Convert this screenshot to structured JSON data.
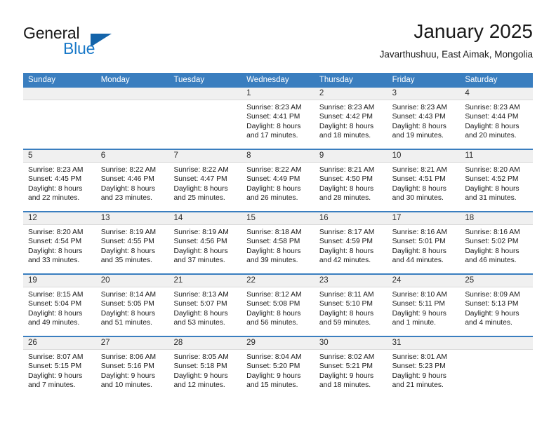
{
  "brand": {
    "name_part1": "General",
    "name_part2": "Blue",
    "accent_color": "#1878c8",
    "triangle_color": "#1464aa"
  },
  "header": {
    "month_title": "January 2025",
    "location": "Javarthushuu, East Aimak, Mongolia"
  },
  "theme": {
    "header_row_color": "#3a7ebf",
    "day_band_color": "#f0f0f0",
    "text_color": "#1a1a1a"
  },
  "weekdays": [
    "Sunday",
    "Monday",
    "Tuesday",
    "Wednesday",
    "Thursday",
    "Friday",
    "Saturday"
  ],
  "weeks": [
    [
      {
        "day": "",
        "empty": true
      },
      {
        "day": "",
        "empty": true
      },
      {
        "day": "",
        "empty": true
      },
      {
        "day": "1",
        "sunrise": "Sunrise: 8:23 AM",
        "sunset": "Sunset: 4:41 PM",
        "daylight1": "Daylight: 8 hours",
        "daylight2": "and 17 minutes."
      },
      {
        "day": "2",
        "sunrise": "Sunrise: 8:23 AM",
        "sunset": "Sunset: 4:42 PM",
        "daylight1": "Daylight: 8 hours",
        "daylight2": "and 18 minutes."
      },
      {
        "day": "3",
        "sunrise": "Sunrise: 8:23 AM",
        "sunset": "Sunset: 4:43 PM",
        "daylight1": "Daylight: 8 hours",
        "daylight2": "and 19 minutes."
      },
      {
        "day": "4",
        "sunrise": "Sunrise: 8:23 AM",
        "sunset": "Sunset: 4:44 PM",
        "daylight1": "Daylight: 8 hours",
        "daylight2": "and 20 minutes."
      }
    ],
    [
      {
        "day": "5",
        "sunrise": "Sunrise: 8:23 AM",
        "sunset": "Sunset: 4:45 PM",
        "daylight1": "Daylight: 8 hours",
        "daylight2": "and 22 minutes."
      },
      {
        "day": "6",
        "sunrise": "Sunrise: 8:22 AM",
        "sunset": "Sunset: 4:46 PM",
        "daylight1": "Daylight: 8 hours",
        "daylight2": "and 23 minutes."
      },
      {
        "day": "7",
        "sunrise": "Sunrise: 8:22 AM",
        "sunset": "Sunset: 4:47 PM",
        "daylight1": "Daylight: 8 hours",
        "daylight2": "and 25 minutes."
      },
      {
        "day": "8",
        "sunrise": "Sunrise: 8:22 AM",
        "sunset": "Sunset: 4:49 PM",
        "daylight1": "Daylight: 8 hours",
        "daylight2": "and 26 minutes."
      },
      {
        "day": "9",
        "sunrise": "Sunrise: 8:21 AM",
        "sunset": "Sunset: 4:50 PM",
        "daylight1": "Daylight: 8 hours",
        "daylight2": "and 28 minutes."
      },
      {
        "day": "10",
        "sunrise": "Sunrise: 8:21 AM",
        "sunset": "Sunset: 4:51 PM",
        "daylight1": "Daylight: 8 hours",
        "daylight2": "and 30 minutes."
      },
      {
        "day": "11",
        "sunrise": "Sunrise: 8:20 AM",
        "sunset": "Sunset: 4:52 PM",
        "daylight1": "Daylight: 8 hours",
        "daylight2": "and 31 minutes."
      }
    ],
    [
      {
        "day": "12",
        "sunrise": "Sunrise: 8:20 AM",
        "sunset": "Sunset: 4:54 PM",
        "daylight1": "Daylight: 8 hours",
        "daylight2": "and 33 minutes."
      },
      {
        "day": "13",
        "sunrise": "Sunrise: 8:19 AM",
        "sunset": "Sunset: 4:55 PM",
        "daylight1": "Daylight: 8 hours",
        "daylight2": "and 35 minutes."
      },
      {
        "day": "14",
        "sunrise": "Sunrise: 8:19 AM",
        "sunset": "Sunset: 4:56 PM",
        "daylight1": "Daylight: 8 hours",
        "daylight2": "and 37 minutes."
      },
      {
        "day": "15",
        "sunrise": "Sunrise: 8:18 AM",
        "sunset": "Sunset: 4:58 PM",
        "daylight1": "Daylight: 8 hours",
        "daylight2": "and 39 minutes."
      },
      {
        "day": "16",
        "sunrise": "Sunrise: 8:17 AM",
        "sunset": "Sunset: 4:59 PM",
        "daylight1": "Daylight: 8 hours",
        "daylight2": "and 42 minutes."
      },
      {
        "day": "17",
        "sunrise": "Sunrise: 8:16 AM",
        "sunset": "Sunset: 5:01 PM",
        "daylight1": "Daylight: 8 hours",
        "daylight2": "and 44 minutes."
      },
      {
        "day": "18",
        "sunrise": "Sunrise: 8:16 AM",
        "sunset": "Sunset: 5:02 PM",
        "daylight1": "Daylight: 8 hours",
        "daylight2": "and 46 minutes."
      }
    ],
    [
      {
        "day": "19",
        "sunrise": "Sunrise: 8:15 AM",
        "sunset": "Sunset: 5:04 PM",
        "daylight1": "Daylight: 8 hours",
        "daylight2": "and 49 minutes."
      },
      {
        "day": "20",
        "sunrise": "Sunrise: 8:14 AM",
        "sunset": "Sunset: 5:05 PM",
        "daylight1": "Daylight: 8 hours",
        "daylight2": "and 51 minutes."
      },
      {
        "day": "21",
        "sunrise": "Sunrise: 8:13 AM",
        "sunset": "Sunset: 5:07 PM",
        "daylight1": "Daylight: 8 hours",
        "daylight2": "and 53 minutes."
      },
      {
        "day": "22",
        "sunrise": "Sunrise: 8:12 AM",
        "sunset": "Sunset: 5:08 PM",
        "daylight1": "Daylight: 8 hours",
        "daylight2": "and 56 minutes."
      },
      {
        "day": "23",
        "sunrise": "Sunrise: 8:11 AM",
        "sunset": "Sunset: 5:10 PM",
        "daylight1": "Daylight: 8 hours",
        "daylight2": "and 59 minutes."
      },
      {
        "day": "24",
        "sunrise": "Sunrise: 8:10 AM",
        "sunset": "Sunset: 5:11 PM",
        "daylight1": "Daylight: 9 hours",
        "daylight2": "and 1 minute."
      },
      {
        "day": "25",
        "sunrise": "Sunrise: 8:09 AM",
        "sunset": "Sunset: 5:13 PM",
        "daylight1": "Daylight: 9 hours",
        "daylight2": "and 4 minutes."
      }
    ],
    [
      {
        "day": "26",
        "sunrise": "Sunrise: 8:07 AM",
        "sunset": "Sunset: 5:15 PM",
        "daylight1": "Daylight: 9 hours",
        "daylight2": "and 7 minutes."
      },
      {
        "day": "27",
        "sunrise": "Sunrise: 8:06 AM",
        "sunset": "Sunset: 5:16 PM",
        "daylight1": "Daylight: 9 hours",
        "daylight2": "and 10 minutes."
      },
      {
        "day": "28",
        "sunrise": "Sunrise: 8:05 AM",
        "sunset": "Sunset: 5:18 PM",
        "daylight1": "Daylight: 9 hours",
        "daylight2": "and 12 minutes."
      },
      {
        "day": "29",
        "sunrise": "Sunrise: 8:04 AM",
        "sunset": "Sunset: 5:20 PM",
        "daylight1": "Daylight: 9 hours",
        "daylight2": "and 15 minutes."
      },
      {
        "day": "30",
        "sunrise": "Sunrise: 8:02 AM",
        "sunset": "Sunset: 5:21 PM",
        "daylight1": "Daylight: 9 hours",
        "daylight2": "and 18 minutes."
      },
      {
        "day": "31",
        "sunrise": "Sunrise: 8:01 AM",
        "sunset": "Sunset: 5:23 PM",
        "daylight1": "Daylight: 9 hours",
        "daylight2": "and 21 minutes."
      },
      {
        "day": "",
        "empty": true
      }
    ]
  ]
}
